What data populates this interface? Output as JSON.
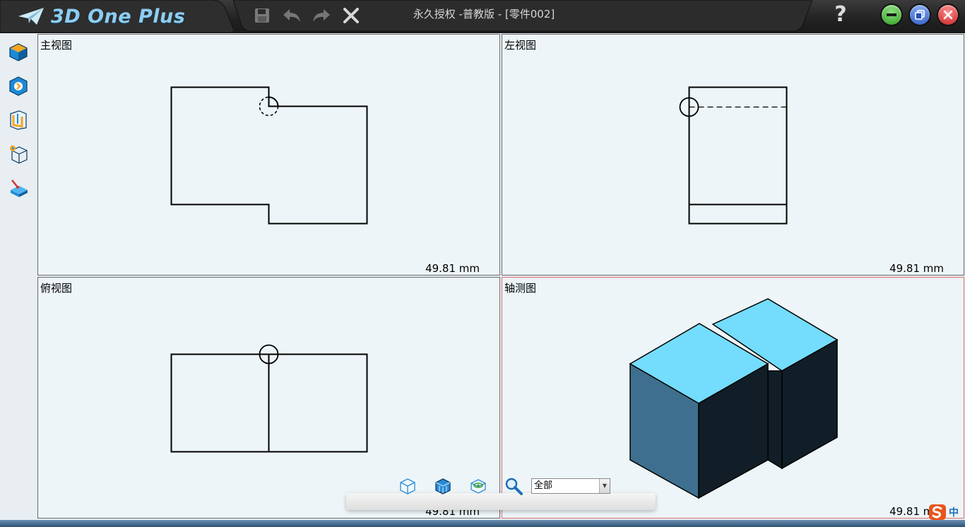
{
  "app": {
    "name": "3D One Plus",
    "document_title": "永久授权 -普教版 - [零件002]",
    "help_label": "?"
  },
  "toolbar": {
    "items": [
      "save-icon",
      "undo-icon",
      "redo-icon",
      "close-icon"
    ]
  },
  "window_controls": {
    "minimize_color": "#3aa52a",
    "maximize_color": "#2b63c4",
    "close_color": "#d32a2a"
  },
  "sidebar": {
    "items": [
      "basic-solid-icon",
      "feature-icon",
      "special-function-icon",
      "base-edit-icon",
      "combine-icon"
    ]
  },
  "panes": [
    {
      "label": "主视图",
      "scale": "49.81 mm",
      "active": false
    },
    {
      "label": "左视图",
      "scale": "49.81 mm",
      "active": false
    },
    {
      "label": "俯视图",
      "scale": "49.81 mm",
      "active": false
    },
    {
      "label": "轴测图",
      "scale": "49.81 mm",
      "active": true
    }
  ],
  "bottom_toolbar": {
    "filter_value": "全部",
    "icons": [
      "view-cube-icon",
      "shaded-view-icon",
      "view-orient-icon",
      "zoom-icon"
    ]
  },
  "colors": {
    "accent": "#2a8ad6",
    "iso_top": "#74dcfc",
    "iso_front": "#3e6f8e",
    "iso_side": "#111e27",
    "active_border": "#e07070"
  },
  "ime": {
    "label": "中"
  }
}
